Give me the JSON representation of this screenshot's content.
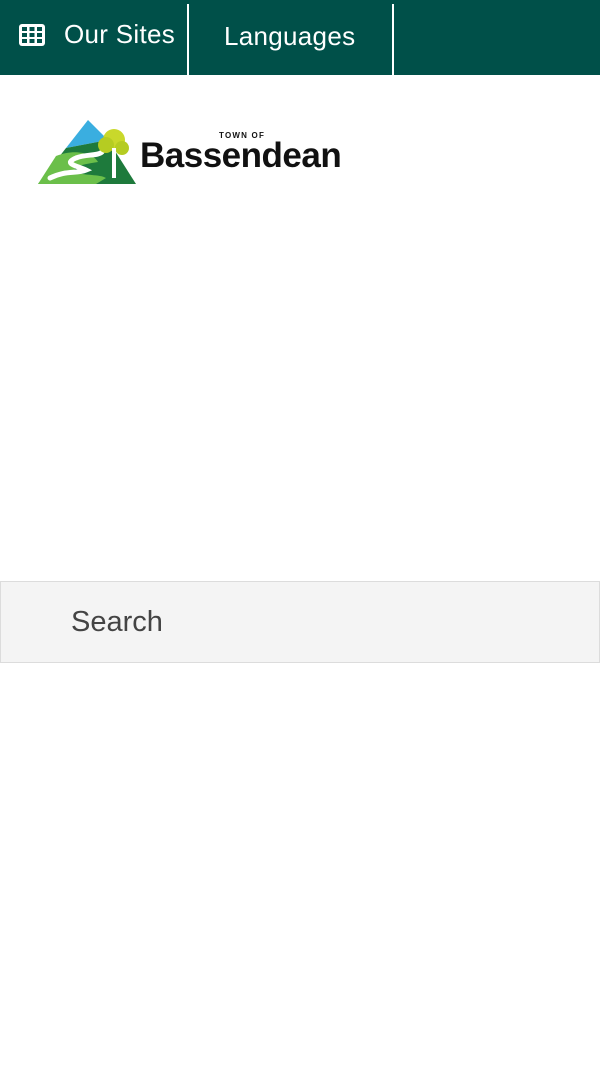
{
  "topbar": {
    "background": "#005049",
    "our_sites": {
      "label": "Our Sites",
      "icon": "grid-icon"
    },
    "languages": {
      "label": "Languages"
    }
  },
  "logo": {
    "town_of": "TOWN OF",
    "name": "Bassendean"
  },
  "search": {
    "placeholder": "Search"
  }
}
